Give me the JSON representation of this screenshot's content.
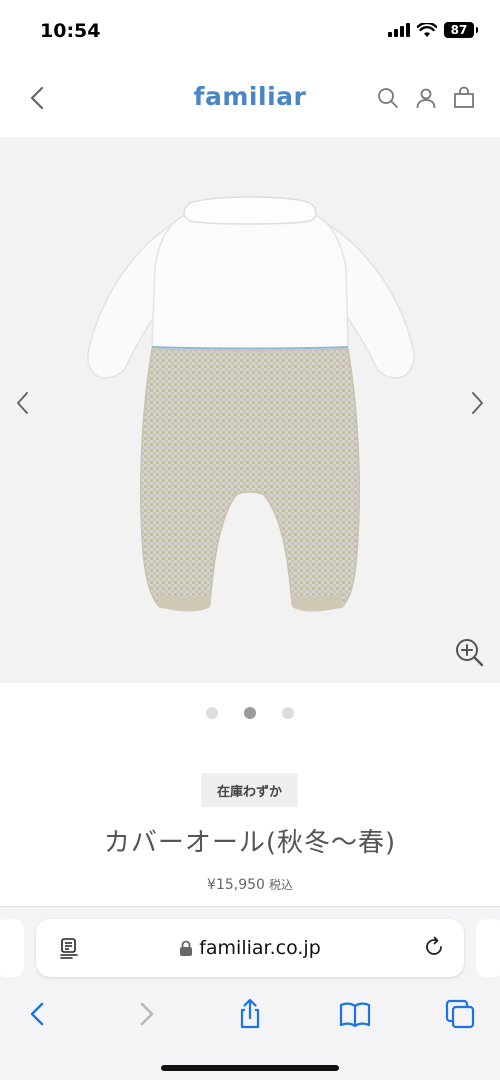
{
  "status": {
    "time": "10:54",
    "battery": "87"
  },
  "header": {
    "logo": "familiar"
  },
  "gallery": {
    "active_index": 1,
    "total": 3
  },
  "product": {
    "stock_badge": "在庫わずか",
    "title": "カバーオール(秋冬〜春)",
    "price": "¥15,950",
    "tax_label": "税込"
  },
  "browser": {
    "url": "familiar.co.jp"
  },
  "colors": {
    "brand": "#4a86c6",
    "ios_blue": "#1a73e8"
  },
  "icons": [
    "back-icon",
    "search-icon",
    "user-icon",
    "bag-icon",
    "chevron-left-icon",
    "chevron-right-icon",
    "zoom-in-icon",
    "reader-icon",
    "lock-icon",
    "reload-icon",
    "share-icon",
    "bookmarks-icon",
    "tabs-icon"
  ]
}
